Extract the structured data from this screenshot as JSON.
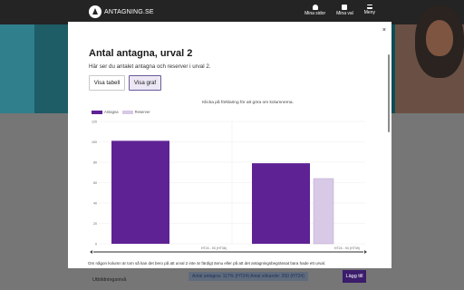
{
  "header": {
    "logo_text": "ANTAGNING.SE",
    "actions": [
      {
        "label": "Mina sidor",
        "icon": "person-icon"
      },
      {
        "label": "Mina val",
        "icon": "bookmark-icon"
      },
      {
        "label": "Meny",
        "icon": "menu-icon"
      }
    ]
  },
  "background": {
    "sidebar_label": "Utbildningsnivå",
    "chip_text": "Antal antagna: 117% (HT24)   Antal sökande: 250 (HT24)",
    "button_label": "Lägg till"
  },
  "modal": {
    "close_glyph": "×",
    "title": "Antal antagna, urval 2",
    "description": "Här ser du antalet antagna och reserver i urval 2.",
    "buttons": {
      "table": "Visa tabell",
      "graph": "Visa graf"
    },
    "hint": "Klicka på förklaring för att göra om kolumnerna.",
    "footnote": "Om någon kolumn är tom så kan det bero på att urval 2 inte är färdigt ännu eller på att det antagningsbegränsat bara hade ett urval."
  },
  "colors": {
    "antagna": "#5e2295",
    "reserver": "#d8c9e6",
    "topbar": "#242424",
    "accent": "#3a1c6b"
  },
  "chart_data": {
    "type": "bar",
    "categories": [
      "HT24 - 93 (HT36)",
      "HT24 - 94 (HT39)"
    ],
    "series": [
      {
        "name": "Antagna",
        "values": [
          101,
          79
        ]
      },
      {
        "name": "Reserver",
        "values": [
          0,
          64
        ]
      }
    ],
    "ylim": [
      0,
      120
    ],
    "yticks": [
      "0",
      "20",
      "40",
      "60",
      "80",
      "100",
      "120"
    ],
    "legend": "top-left"
  }
}
